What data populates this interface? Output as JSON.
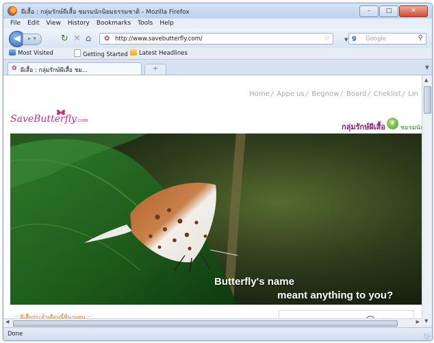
{
  "window": {
    "title": "ผีเสื้อ : กลุ่มรักษ์ผีเสื้อ ชมรมนักนิยมธรรมชาติ - Mozilla Firefox",
    "controls": {
      "minimize": "–",
      "maximize": "□",
      "close": "✕"
    }
  },
  "menu": [
    "File",
    "Edit",
    "View",
    "History",
    "Bookmarks",
    "Tools",
    "Help"
  ],
  "nav": {
    "url": "http://www.savebutterfly.com/",
    "search_placeholder": "Google",
    "google_icon": "g"
  },
  "bookmarks": [
    "Most Visited",
    "Getting Started",
    "Latest Headlines"
  ],
  "tabs": [
    {
      "label": "ผีเสื้อ : กลุ่มรักษ์ผีเสื้อ ชม..."
    }
  ],
  "page": {
    "nav_links": [
      "Home",
      "Appe us",
      "Begnow",
      "Board",
      "Cheklist",
      "Lin"
    ],
    "logo_text": "SaveButterfly",
    "logo_suffix": ".com",
    "org_name": "กลุ่มรักษ์ผีเสื้อ",
    "org_name2": "ชมรมนักนิยมธรรมชาติ",
    "hero_line1": "Butterfly's name",
    "hero_line2": "meant anything to you?",
    "footer_link": ".:: ผีเสื้อประจำเดือนนี้ที่นานหน ::."
  },
  "status": "Done"
}
